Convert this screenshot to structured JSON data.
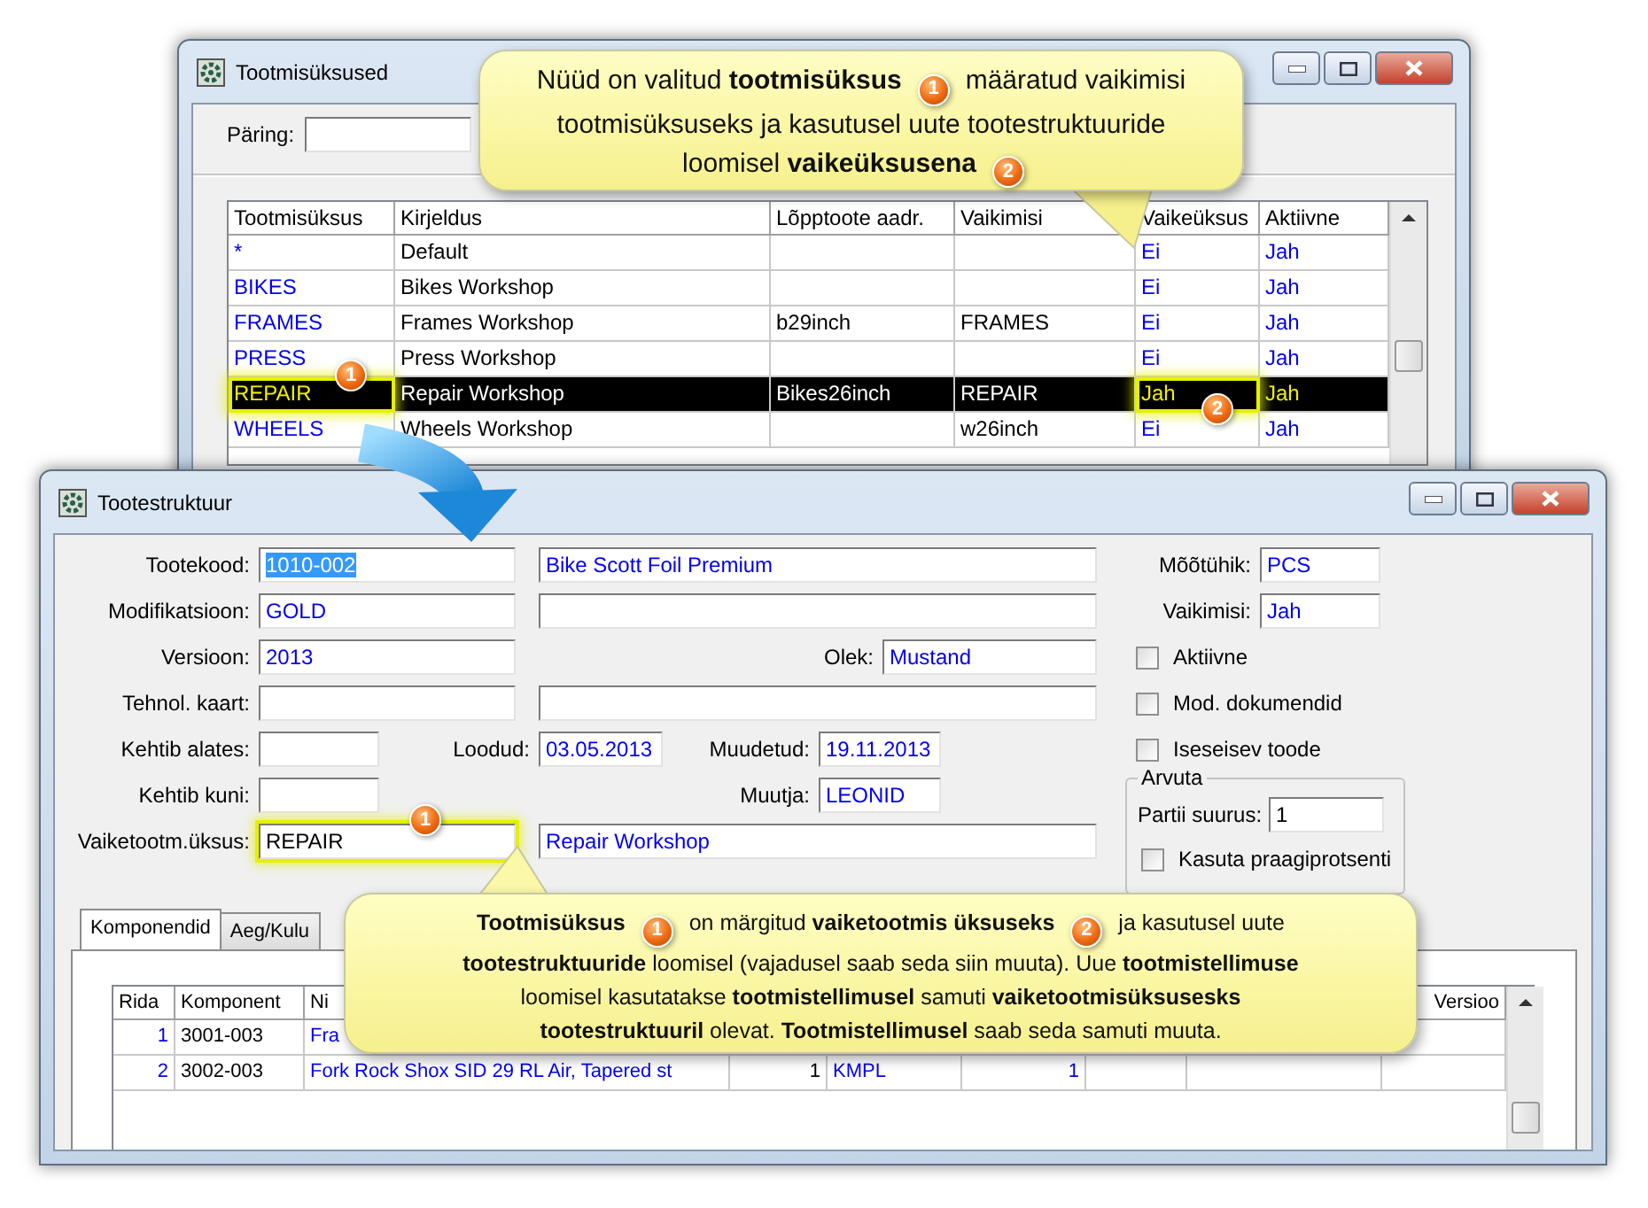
{
  "query_window": {
    "title": "Tootmisüksused",
    "query_label": "Päring:",
    "columns": [
      "Tootmisüksus",
      "Kirjeldus",
      "Lõpptoote aadr.",
      "Vaikimisi",
      "Vaikeüksus",
      "Aktiivne"
    ],
    "rows": [
      {
        "selected": false,
        "cells": [
          {
            "text": "*"
          },
          {
            "text": "Default"
          },
          null,
          null,
          {
            "text": "Ei"
          },
          {
            "text": "Jah"
          }
        ]
      },
      {
        "selected": false,
        "cells": [
          {
            "text": "BIKES"
          },
          {
            "text": "Bikes Workshop"
          },
          null,
          null,
          {
            "text": "Ei"
          },
          {
            "text": "Jah"
          }
        ]
      },
      {
        "selected": false,
        "cells": [
          {
            "text": "FRAMES"
          },
          {
            "text": "Frames Workshop"
          },
          {
            "text": "b29inch"
          },
          {
            "text": "FRAMES"
          },
          {
            "text": "Ei"
          },
          {
            "text": "Jah"
          }
        ]
      },
      {
        "selected": false,
        "cells": [
          {
            "text": "PRESS"
          },
          {
            "text": "Press Workshop"
          },
          null,
          null,
          {
            "text": "Ei"
          },
          {
            "text": "Jah"
          }
        ]
      },
      {
        "selected": true,
        "cells": [
          {
            "text": "REPAIR",
            "badge": "1"
          },
          {
            "text": "Repair Workshop"
          },
          {
            "text": "Bikes26inch"
          },
          {
            "text": "REPAIR"
          },
          {
            "text": "Jah",
            "badge": "2"
          },
          {
            "text": "Jah"
          }
        ]
      },
      {
        "selected": false,
        "cells": [
          {
            "text": "WHEELS"
          },
          {
            "text": "Wheels Workshop"
          },
          null,
          {
            "text": "w26inch"
          },
          {
            "text": "Ei"
          },
          {
            "text": "Jah"
          }
        ]
      }
    ]
  },
  "product_window": {
    "title": "Tootestruktuur",
    "product_code": {
      "label": "Tootekood:",
      "value": "1010-002",
      "text_selected": true
    },
    "product_name": {
      "value": "Bike Scott Foil Premium"
    },
    "modification": {
      "label": "Modifikatsioon:",
      "value": "GOLD"
    },
    "version": {
      "label": "Versioon:",
      "value": "2013"
    },
    "status": {
      "label": "Olek:",
      "value": "Mustand"
    },
    "routing": {
      "label": "Tehnol. kaart:"
    },
    "valid_from": {
      "label": "Kehtib alates:"
    },
    "created": {
      "label": "Loodud:",
      "value": "03.05.2013"
    },
    "modified": {
      "label": "Muudetud:",
      "value": "19.11.2013"
    },
    "valid_to": {
      "label": "Kehtib kuni:"
    },
    "modified_by": {
      "label": "Muutja:",
      "value": "LEONID"
    },
    "default_unit": {
      "label": "Vaiketootm.üksus:",
      "value": "REPAIR",
      "badge": "1"
    },
    "default_unit_name": {
      "value": "Repair Workshop"
    },
    "uom": {
      "label": "Mõõtühik:",
      "value": "PCS"
    },
    "default": {
      "label": "Vaikimisi:",
      "value": "Jah"
    },
    "checkboxes": [
      {
        "label": "Aktiivne",
        "checked": false
      },
      {
        "label": "Mod. dokumendid",
        "checked": false
      },
      {
        "label": "Iseseisev toode",
        "checked": false
      }
    ],
    "calc_group": {
      "title": "Arvuta",
      "batch_label": "Partii suurus:",
      "batch_value": "1",
      "checkbox": {
        "label": "Kasuta praagiprotsenti",
        "checked": false
      }
    },
    "tabs": [
      {
        "label": "Komponendid",
        "selected": true
      },
      {
        "label": "Aeg/Kulu",
        "selected": false
      }
    ],
    "components": {
      "columns": [
        "Rida",
        "Komponent",
        "Ni",
        "Versioo"
      ],
      "rows": [
        {
          "cells": [
            "1",
            "3001-003",
            "Fra"
          ]
        },
        {
          "cells": [
            "2",
            "3002-003",
            "Fork Rock Shox SID 29 RL Air, Tapered st",
            "1",
            "KMPL",
            "1"
          ]
        }
      ]
    }
  },
  "callouts": [
    {
      "lines": [
        [
          {
            "kind": "text",
            "text": "Nüüd on valitud **tootmisüksus**"
          },
          {
            "kind": "badge",
            "text": "1"
          },
          {
            "kind": "text",
            "text": "määratud vaikimisi"
          }
        ],
        [
          {
            "kind": "text",
            "text": "tootmisüksuseks ja kasutusel uute tootestruktuuride"
          }
        ],
        [
          {
            "kind": "text",
            "text": "loomisel **vaikeüksusena**"
          },
          {
            "kind": "badge",
            "text": "2"
          }
        ]
      ]
    },
    {
      "lines": [
        [
          {
            "kind": "text",
            "text": "**Tootmisüksus**"
          },
          {
            "kind": "badge",
            "text": "1"
          },
          {
            "kind": "text",
            "text": "on märgitud **vaiketootmis üksuseks**"
          },
          {
            "kind": "badge",
            "text": "2"
          },
          {
            "kind": "text",
            "text": "ja kasutusel uute"
          }
        ],
        [
          {
            "kind": "text",
            "text": "**tootestruktuuride** loomisel (vajadusel saab seda siin muuta). Uue **tootmistellimuse**"
          }
        ],
        [
          {
            "kind": "text",
            "text": "loomisel kasutatakse **tootmistellimusel** samuti **vaiketootmisüksusesks**"
          }
        ],
        [
          {
            "kind": "text",
            "text": "**tootestruktuuril** olevat.  **Tootmistellimusel** saab seda samuti muuta."
          }
        ]
      ]
    }
  ]
}
